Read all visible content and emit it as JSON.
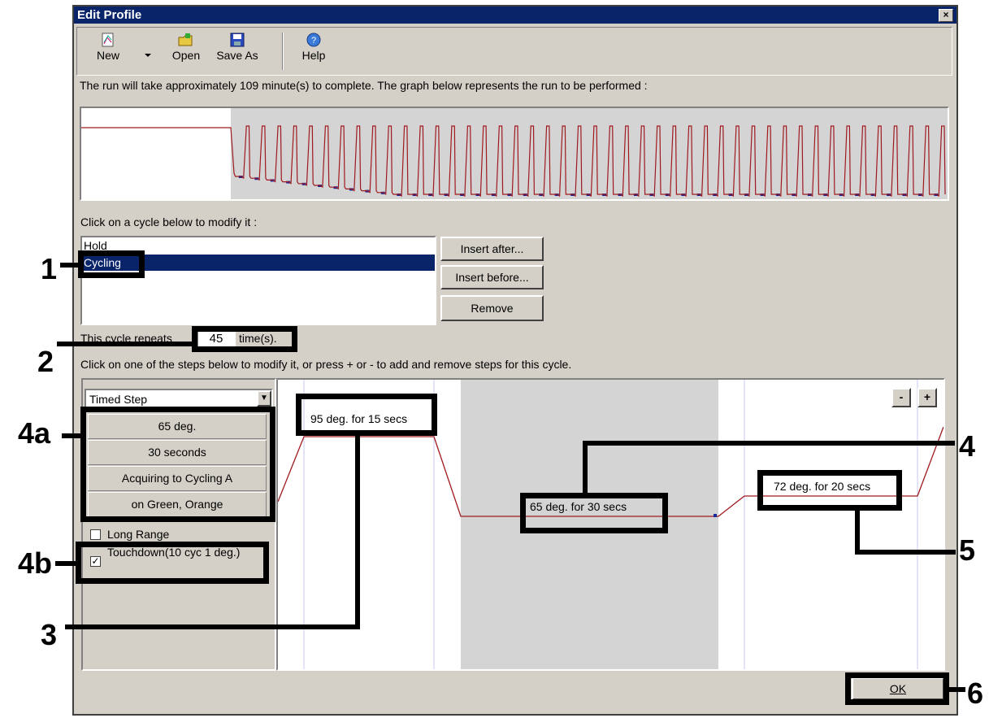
{
  "window": {
    "title": "Edit Profile",
    "close_glyph": "×"
  },
  "toolbar": {
    "new_label": "New",
    "open_label": "Open",
    "saveas_label": "Save As",
    "help_label": "Help"
  },
  "summary_text": "The run will take approximately 109 minute(s) to complete. The graph below represents the run to be performed :",
  "cycle_prompt": "Click on a cycle below to modify it :",
  "cycles": [
    {
      "label": "Hold"
    },
    {
      "label": "Cycling",
      "selected": true
    }
  ],
  "cycle_buttons": {
    "insert_after": "Insert after...",
    "insert_before": "Insert before...",
    "remove": "Remove"
  },
  "repeat": {
    "prefix": "This cycle repeats",
    "value": "45",
    "suffix": "time(s)."
  },
  "steps_prompt": "Click on one of the steps below to modify it, or press + or - to add and remove steps for this cycle.",
  "step_type": "Timed Step",
  "step_settings": {
    "temperature": "65 deg.",
    "duration": "30 seconds",
    "acquiring": "Acquiring to Cycling A",
    "channels": "on Green, Orange"
  },
  "options": {
    "long_range": {
      "label": "Long Range",
      "checked": false
    },
    "touchdown": {
      "label": "Touchdown(10 cyc 1 deg.)",
      "checked": true
    }
  },
  "steps": [
    {
      "label": "95 deg. for 15 secs"
    },
    {
      "label": "65 deg. for 30 secs"
    },
    {
      "label": "72 deg. for 20 secs"
    }
  ],
  "step_controls": {
    "minus": "-",
    "plus": "+"
  },
  "ok_label": "OK",
  "callouts": {
    "c1": "1",
    "c2": "2",
    "c3": "3",
    "c4": "4",
    "c4a": "4a",
    "c4b": "4b",
    "c5": "5",
    "c6": "6"
  },
  "colors": {
    "title_bg": "#0a246a",
    "selection": "#0a246a",
    "trace": "#a0191e",
    "marker": "#1a2a9a"
  }
}
